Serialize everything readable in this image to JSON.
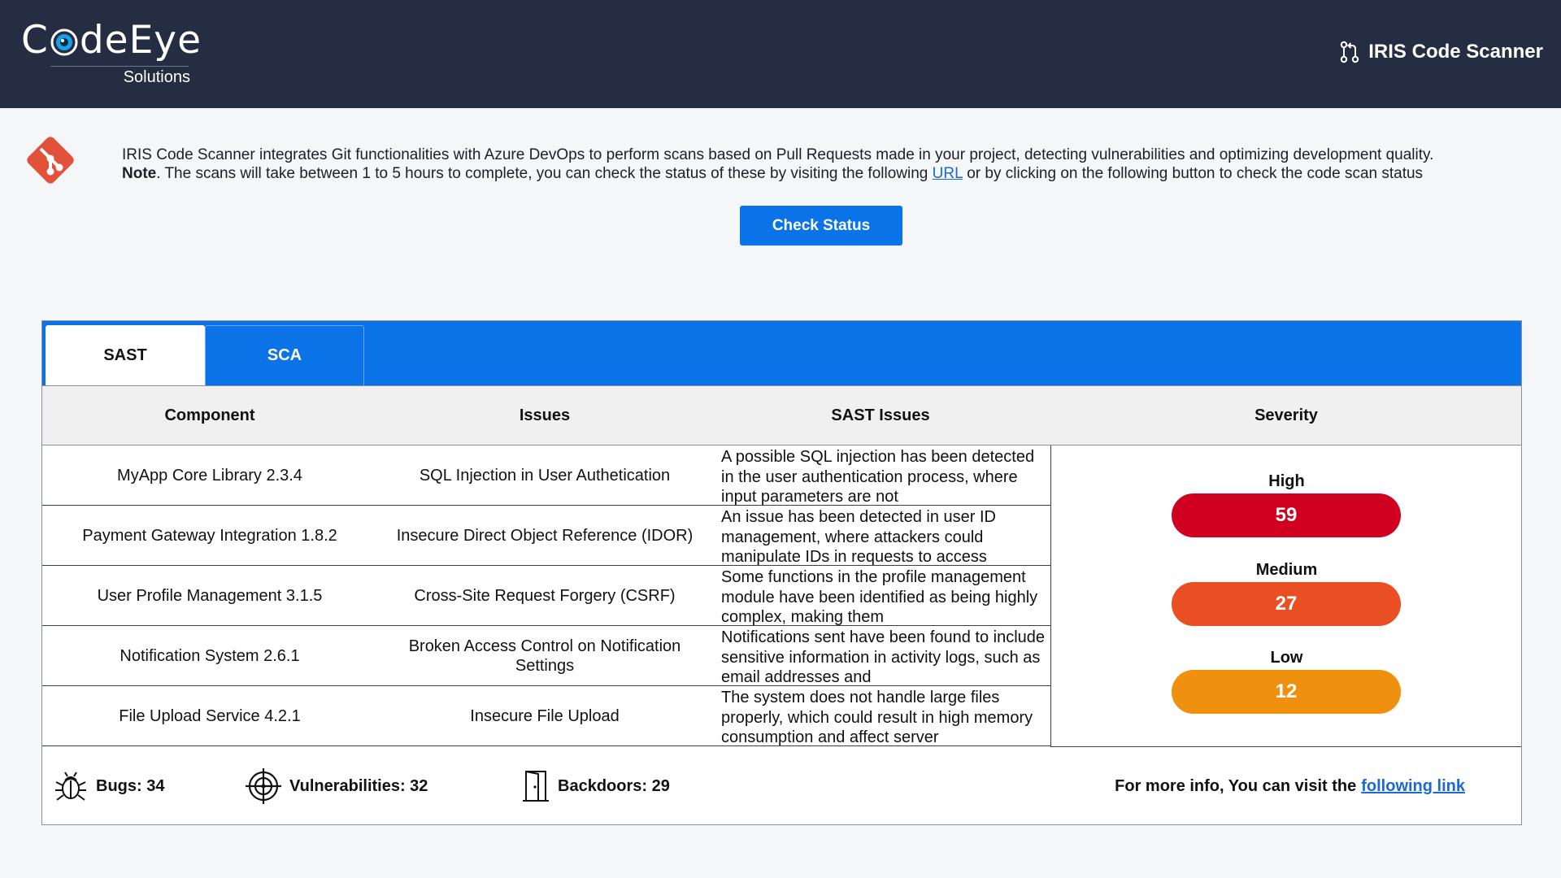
{
  "header": {
    "logo_text_start": "C",
    "logo_text_end": "deEye",
    "logo_sub": "Solutions",
    "brand_icon": "pull-request-icon",
    "brand_title": "IRIS Code Scanner"
  },
  "intro": {
    "icon": "git-icon",
    "line1": "IRIS Code Scanner integrates Git functionalities with Azure DevOps to perform scans based on Pull Requests made in your project, detecting vulnerabilities and optimizing development quality.",
    "note_label": "Note",
    "note_text_before": ". The scans will take between 1 to 5 hours to complete, you can check the status of these by visiting the following ",
    "note_link": "URL",
    "note_text_after": " or by clicking on the following button to check the code scan status",
    "check_button": "Check Status"
  },
  "tabs": [
    {
      "label": "SAST",
      "active": true
    },
    {
      "label": "SCA",
      "active": false
    }
  ],
  "table": {
    "headers": [
      "Component",
      "Issues",
      "SAST Issues",
      "Severity"
    ],
    "rows": [
      {
        "component": "MyApp Core Library 2.3.4",
        "issue": "SQL Injection in User Authetication",
        "sast": "A possible SQL injection has been detected in the user authentication process, where input parameters are not"
      },
      {
        "component": "Payment Gateway Integration 1.8.2",
        "issue": "Insecure Direct Object Reference (IDOR)",
        "sast": "An issue has been detected in user ID management, where attackers could manipulate IDs in requests to access"
      },
      {
        "component": "User Profile Management 3.1.5",
        "issue": "Cross-Site Request Forgery (CSRF)",
        "sast": "Some functions in the profile management module have been identified as being highly complex, making them"
      },
      {
        "component": "Notification System 2.6.1",
        "issue": "Broken Access Control on Notification Settings",
        "sast": "Notifications sent have been found to include sensitive information in activity logs, such as email addresses and"
      },
      {
        "component": "File Upload Service 4.2.1",
        "issue": "Insecure File Upload",
        "sast": "The system does not handle large files properly, which could result in high memory consumption and affect server"
      }
    ]
  },
  "severity": {
    "high_label": "High",
    "high_count": "59",
    "high_color": "#cf0020",
    "medium_label": "Medium",
    "medium_count": "27",
    "medium_color": "#ea4f23",
    "low_label": "Low",
    "low_count": "12",
    "low_color": "#f0900f"
  },
  "footer": {
    "bugs_icon": "bug-icon",
    "bugs": "Bugs: 34",
    "vulns_icon": "crosshair-icon",
    "vulnerabilities": "Vulnerabilities: 32",
    "backdoors_icon": "door-icon",
    "backdoors": "Backdoors: 29",
    "more_text": "For more info, You can visit the",
    "more_link": "following link"
  },
  "colors": {
    "header_bg": "#242d42",
    "accent": "#0a73e8",
    "git_icon": "#e2513a",
    "link": "#1a6ad4"
  }
}
